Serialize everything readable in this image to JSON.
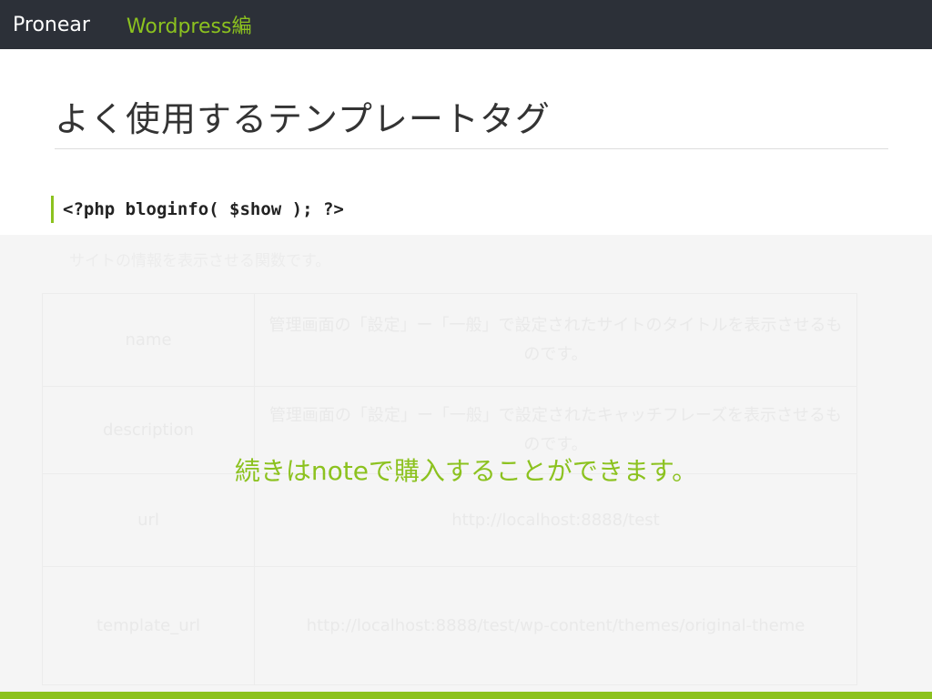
{
  "header": {
    "brand": "Pronear",
    "category": "Wordpress編"
  },
  "slide": {
    "title": "よく使用するテンプレートタグ",
    "code": "<?php bloginfo( $show ); ?>",
    "continue_note": "続きはnoteで購入することができます。"
  },
  "faded": {
    "description": "サイトの情報を表示させる関数です。",
    "rows": [
      {
        "key": "name",
        "value": "管理画面の「設定」ー「一般」で設定されたサイトのタイトルを表示させるものです。"
      },
      {
        "key": "description",
        "value": "管理画面の「設定」ー「一般」で設定されたキャッチフレーズを表示させるものです。"
      },
      {
        "key": "url",
        "value": "http://localhost:8888/test"
      },
      {
        "key": "template_url",
        "value": "http://localhost:8888/test/wp-content/themes/original-theme"
      }
    ]
  },
  "colors": {
    "accent": "#8cc21f",
    "topbar": "#2c3038"
  }
}
